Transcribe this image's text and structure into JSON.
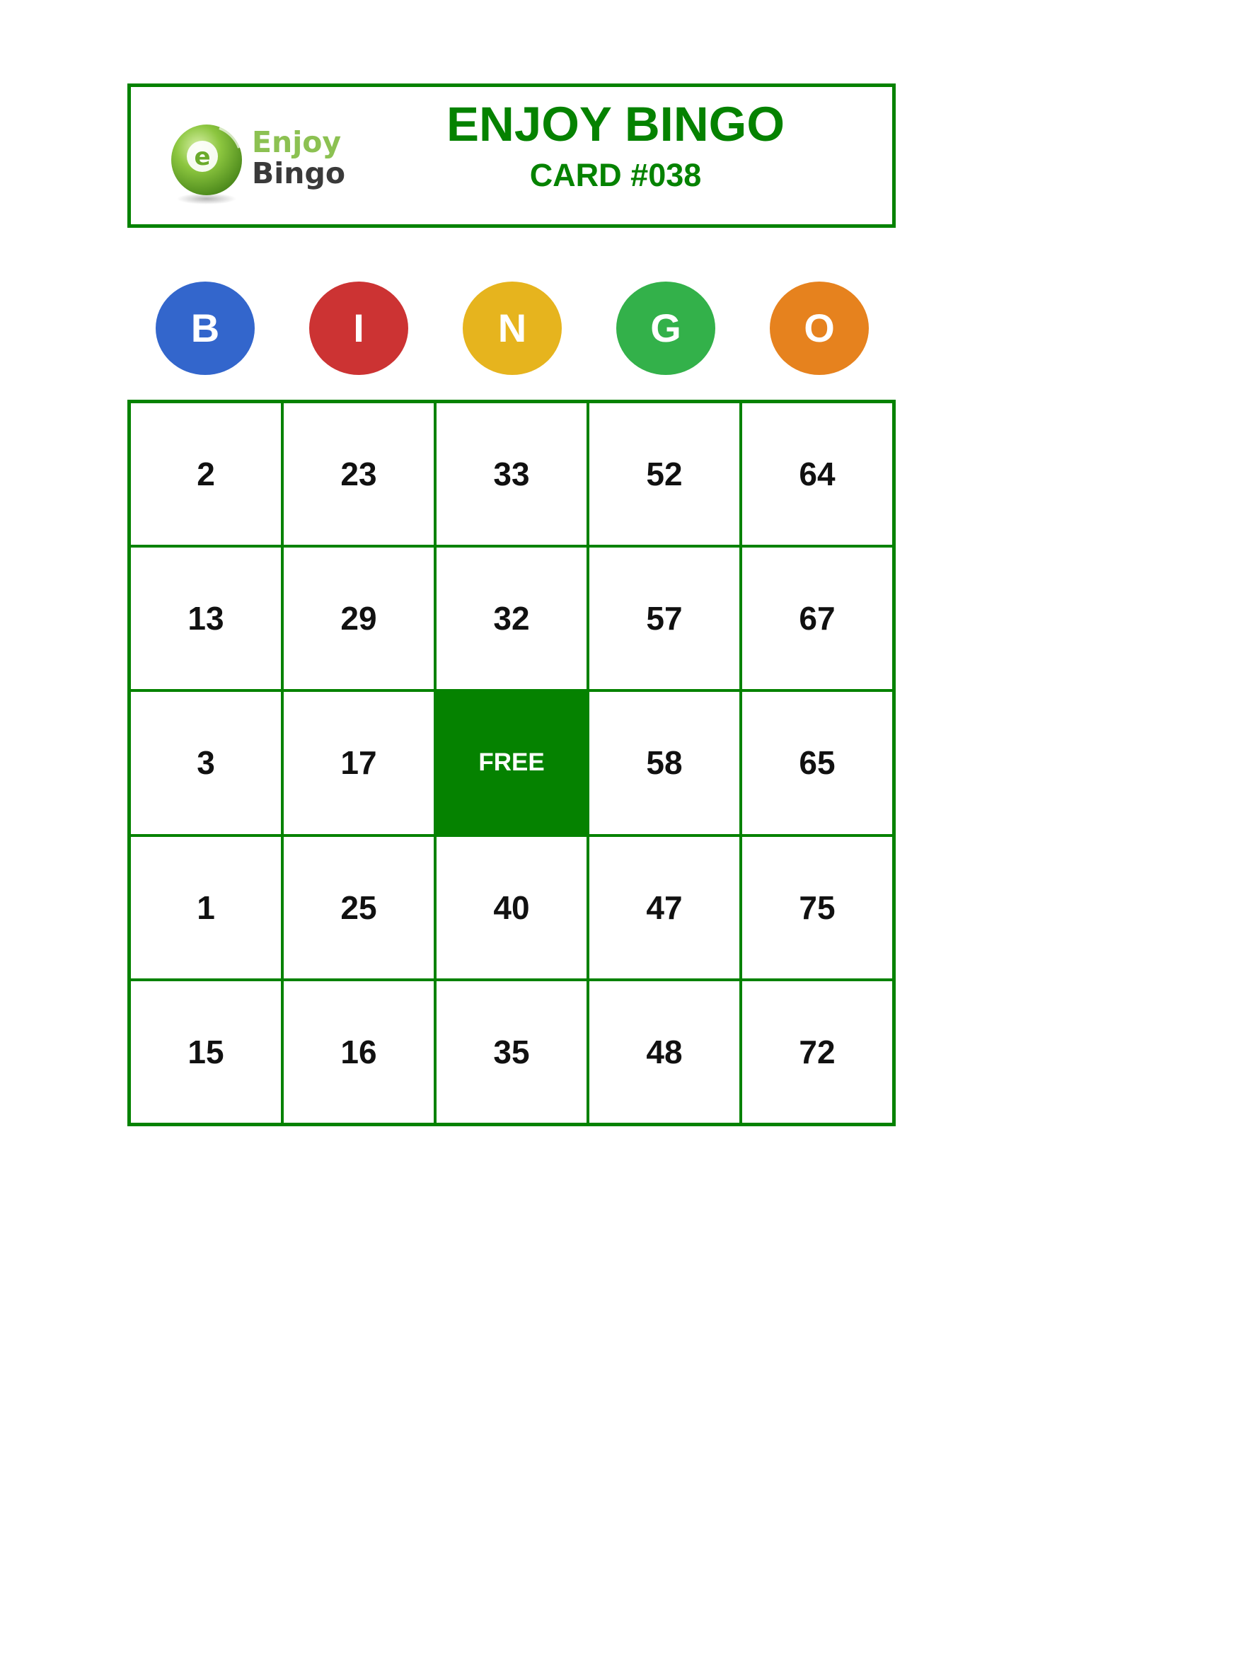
{
  "logo": {
    "icon": "green-bingo-ball-icon",
    "ball_letter": "e",
    "word_top": "Enjoy",
    "word_bottom": "Bingo",
    "colors": {
      "word_top": "#8cc152",
      "word_bottom": "#3a3a3a",
      "ball": "#8cc63f"
    }
  },
  "header": {
    "title": "ENJOY BINGO",
    "card_number": "CARD #038"
  },
  "letters": [
    {
      "label": "B",
      "color": "#3366cc"
    },
    {
      "label": "I",
      "color": "#cc3333"
    },
    {
      "label": "N",
      "color": "#e6b41e"
    },
    {
      "label": "G",
      "color": "#33b14a"
    },
    {
      "label": "O",
      "color": "#e6821e"
    }
  ],
  "grid": [
    [
      "2",
      "23",
      "33",
      "52",
      "64"
    ],
    [
      "13",
      "29",
      "32",
      "57",
      "67"
    ],
    [
      "3",
      "17",
      "FREE",
      "58",
      "65"
    ],
    [
      "1",
      "25",
      "40",
      "47",
      "75"
    ],
    [
      "15",
      "16",
      "35",
      "48",
      "72"
    ]
  ],
  "free_label": "FREE",
  "colors": {
    "brand_green": "#058200",
    "cell_text": "#111111",
    "free_text": "#ffffff"
  }
}
